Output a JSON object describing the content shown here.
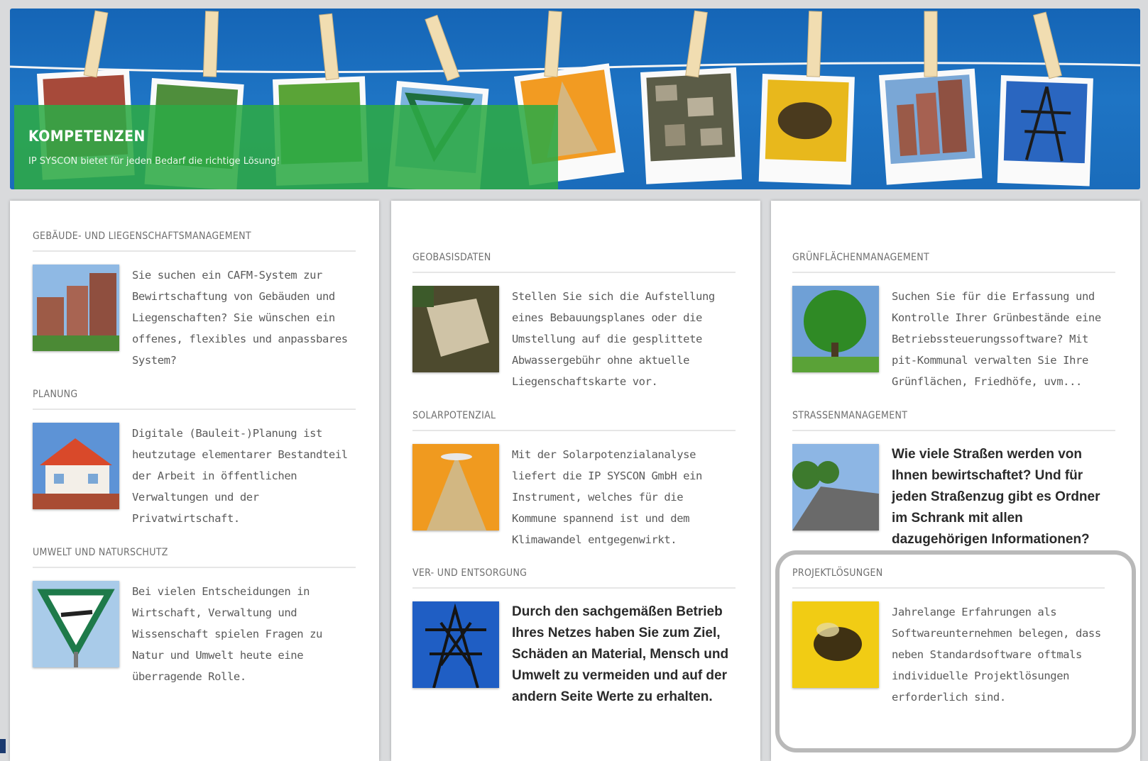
{
  "banner": {
    "title": "KOMPETENZEN",
    "subtitle": "IP SYSCON bietet für jeden Bedarf die richtige Lösung!"
  },
  "columns": [
    {
      "sections": [
        {
          "title": "GEBÄUDE- UND LIEGENSCHAFTSMANAGEMENT",
          "text": "Sie suchen ein CAFM-System zur Bewirtschaftung von Gebäuden und Liegenschaften? Sie wünschen ein offenes, flexibles und anpassbares System?"
        },
        {
          "title": "PLANUNG",
          "text": "Digitale (Bauleit-)Planung ist heutzutage elementarer Bestandteil der Arbeit in öffentlichen Verwaltungen und der Privatwirtschaft."
        },
        {
          "title": "UMWELT UND NATURSCHUTZ",
          "text": "Bei vielen Entscheidungen in Wirtschaft, Verwaltung und Wissenschaft spielen Fragen zu Natur und Umwelt heute eine überragende Rolle."
        }
      ]
    },
    {
      "sections": [
        {
          "title": "GEOBASISDATEN",
          "text": "Stellen Sie sich die Aufstellung eines Bebauungsplanes oder die Umstellung auf die gesplittete Abwassergebühr ohne aktuelle Liegenschaftskarte vor."
        },
        {
          "title": "SOLARPOTENZIAL",
          "text": "Mit der Solarpotenzialanalyse liefert die IP SYSCON GmbH ein Instrument, welches für die Kommune spannend ist und dem Klimawandel entgegenwirkt."
        },
        {
          "title": "VER- UND ENTSORGUNG",
          "text": "Durch den sachgemäßen Betrieb Ihres Netzes haben Sie zum Ziel, Schäden an Material, Mensch und Umwelt zu vermeiden und auf der andern Seite Werte zu erhalten."
        }
      ]
    },
    {
      "sections": [
        {
          "title": "GRÜNFLÄCHENMANAGEMENT",
          "text": "Suchen Sie für die Erfassung und Kontrolle Ihrer Grünbestände eine Betriebssteuerungssoftware? Mit pit-Kommunal verwalten Sie Ihre Grünflächen, Friedhöfe, uvm..."
        },
        {
          "title": "STRASSENMANAGEMENT",
          "text": "Wie viele Straßen werden von Ihnen bewirtschaftet? Und für jeden Straßenzug gibt es Ordner im Schrank mit allen dazugehörigen Informationen?"
        },
        {
          "title": "PROJEKTLÖSUNGEN",
          "text": "Jahrelange Erfahrungen als Softwareunternehmen belegen, dass neben Standardsoftware oftmals individuelle Projektlösungen erforderlich sind."
        }
      ]
    }
  ]
}
